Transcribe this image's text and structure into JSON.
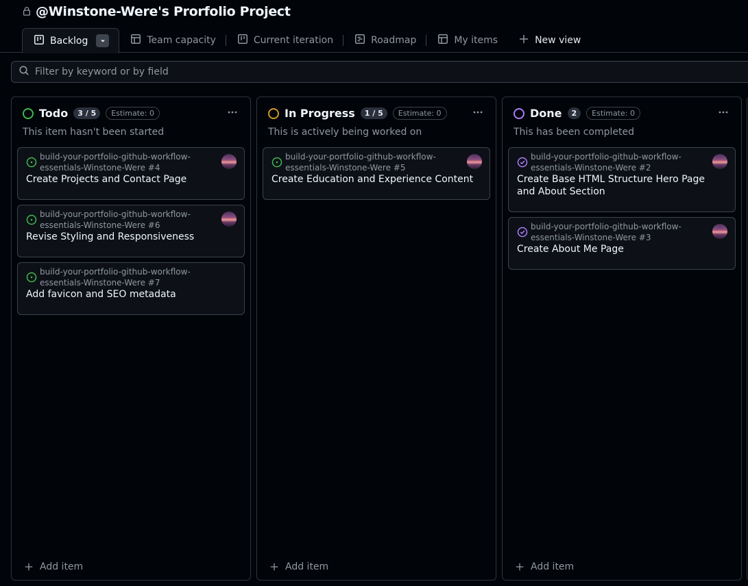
{
  "project": {
    "title": "@Winstone-Were's Prorfolio Project",
    "lock_icon": "lock-icon"
  },
  "tabs": [
    {
      "label": "Backlog",
      "icon": "board-icon",
      "active": true
    },
    {
      "label": "Team capacity",
      "icon": "table-icon"
    },
    {
      "label": "Current iteration",
      "icon": "board-icon"
    },
    {
      "label": "Roadmap",
      "icon": "roadmap-icon"
    },
    {
      "label": "My items",
      "icon": "table-icon"
    },
    {
      "label": "New view",
      "icon": "plus-icon"
    }
  ],
  "filter": {
    "placeholder": "Filter by keyword or by field"
  },
  "columns": [
    {
      "name": "Todo",
      "count": "3 / 5",
      "estimate": "Estimate: 0",
      "description": "This item hasn't been started",
      "color": "#3fb950",
      "add_label": "Add item",
      "cards": [
        {
          "repo": "build-your-portfolio-github-workflow-essentials-Winstone-Were #4",
          "title": "Create Projects and Contact Page",
          "status": "open"
        },
        {
          "repo": "build-your-portfolio-github-workflow-essentials-Winstone-Were #6",
          "title": "Revise Styling and Responsiveness",
          "status": "open"
        },
        {
          "repo": "build-your-portfolio-github-workflow-essentials-Winstone-Were #7",
          "title": "Add favicon and SEO metadata",
          "status": "open"
        }
      ]
    },
    {
      "name": "In Progress",
      "count": "1 / 5",
      "estimate": "Estimate: 0",
      "description": "This is actively being worked on",
      "color": "#d29922",
      "add_label": "Add item",
      "cards": [
        {
          "repo": "build-your-portfolio-github-workflow-essentials-Winstone-Were #5",
          "title": "Create Education and Experience Content",
          "status": "open"
        }
      ]
    },
    {
      "name": "Done",
      "count": "2",
      "estimate": "Estimate: 0",
      "description": "This has been completed",
      "color": "#ab7df8",
      "add_label": "Add item",
      "cards": [
        {
          "repo": "build-your-portfolio-github-workflow-essentials-Winstone-Were #2",
          "title": "Create Base HTML Structure Hero Page and About Section",
          "status": "closed"
        },
        {
          "repo": "build-your-portfolio-github-workflow-essentials-Winstone-Were #3",
          "title": "Create About Me Page",
          "status": "closed"
        }
      ]
    }
  ]
}
